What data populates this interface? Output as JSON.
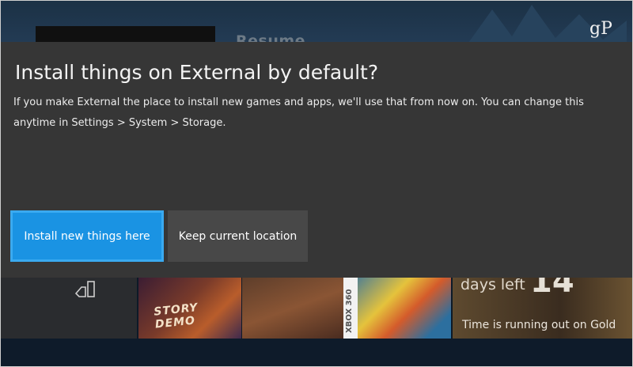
{
  "background": {
    "section_title": "Resume",
    "watermark": "gP",
    "tiles": {
      "hero_text": "STORY DEMO",
      "x360_label": "XBOX 360",
      "gold_days_left": "days left",
      "gold_days_number": "14",
      "gold_caption": "Time is running out on Gold"
    }
  },
  "dialog": {
    "title": "Install things on External by default?",
    "body": "If you make External the place to install new games and apps, we'll use that from now on. You can change this anytime in Settings > System > Storage.",
    "primary_label": "Install new things here",
    "secondary_label": "Keep current location"
  },
  "colors": {
    "accent": "#1a93e3",
    "dialog_bg": "#363636",
    "secondary_button_bg": "#484848"
  }
}
